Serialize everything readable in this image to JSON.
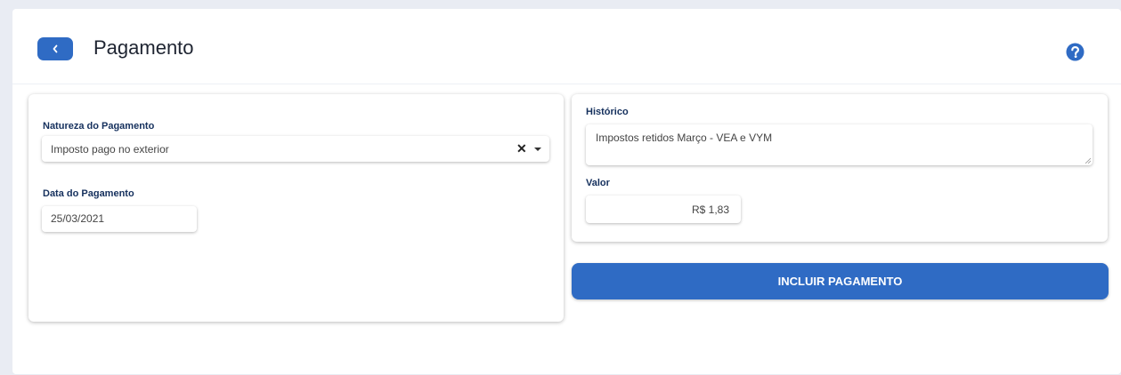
{
  "header": {
    "title": "Pagamento",
    "back_icon": "chevron-left-icon",
    "help_icon": "question-circle-icon"
  },
  "left_card": {
    "natureza_label": "Natureza do Pagamento",
    "natureza_value": "Imposto pago no exterior",
    "clear_symbol": "✕",
    "data_label": "Data do Pagamento",
    "data_value": "25/03/2021"
  },
  "right_card": {
    "historico_label": "Histórico",
    "historico_value": "Impostos retidos Março - VEA e VYM",
    "valor_label": "Valor",
    "valor_value": "R$ 1,83"
  },
  "actions": {
    "submit_label": "INCLUIR PAGAMENTO"
  },
  "colors": {
    "accent": "#2f6bc4",
    "label": "#15305d",
    "background": "#e9ecf3"
  }
}
